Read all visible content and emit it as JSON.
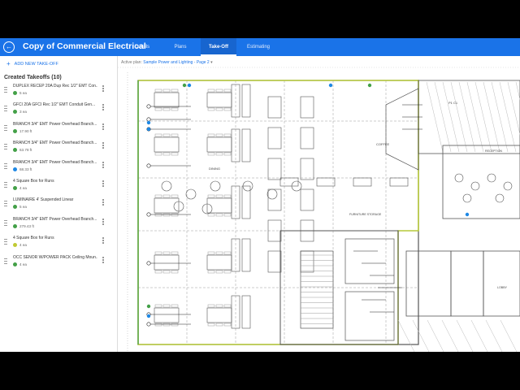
{
  "header": {
    "title": "Copy of Commercial Electrical",
    "tabs": [
      {
        "label": "Details",
        "active": false
      },
      {
        "label": "Plans",
        "active": false
      },
      {
        "label": "Take-Off",
        "active": true
      },
      {
        "label": "Estimating",
        "active": false
      }
    ]
  },
  "sidebar": {
    "add_label": "ADD NEW TAKE-OFF",
    "created_title": "Created Takeoffs (10)",
    "items": [
      {
        "name": "DUPLEX RECEP 20A Dup Rec 1/2\" EMT Con...",
        "qty": "5 ea",
        "color": "#43a047"
      },
      {
        "name": "GFCI 20A GFCI Rec 1/2\" EMT Conduit Gen...",
        "qty": "3 ea",
        "color": "#43a047"
      },
      {
        "name": "BRANCH 3/4\" EMT Power Overhead Branch...",
        "qty": "17.90 ft",
        "color": "#43a047"
      },
      {
        "name": "BRANCH 3/4\" EMT Power Overhead Branch...",
        "qty": "63.78 ft",
        "color": "#43a047"
      },
      {
        "name": "BRANCH 3/4\" EMT Power Overhead Branch...",
        "qty": "68.33 ft",
        "color": "#1e88e5"
      },
      {
        "name": "4 Square Box for Runs",
        "qty": "4 ea",
        "color": "#43a047"
      },
      {
        "name": "LUMINAIRE 4' Suspended Linear",
        "qty": "5 ea",
        "color": "#43a047"
      },
      {
        "name": "BRANCH 3/4\" EMT Power Overhead Branch...",
        "qty": "279.43 ft",
        "color": "#43a047"
      },
      {
        "name": "4 Square Box for Runs",
        "qty": "4 ea",
        "color": "#c0ca33"
      },
      {
        "name": "OCC SENOR W/POWER PACK Ceiling Moun...",
        "qty": "4 ea",
        "color": "#43a047"
      }
    ]
  },
  "canvas": {
    "active_prefix": "Active plan:",
    "active_plan": "Sample Power and Lighting - Page 2",
    "labels": {
      "dining": "DINING",
      "coffee": "COFFEE",
      "furniture": "FURNITURE\nSTORAGE",
      "reception": "RECEPTION",
      "lobby": "LOBBY",
      "ref_p1": "P1",
      "ref_c1": "C1"
    }
  }
}
